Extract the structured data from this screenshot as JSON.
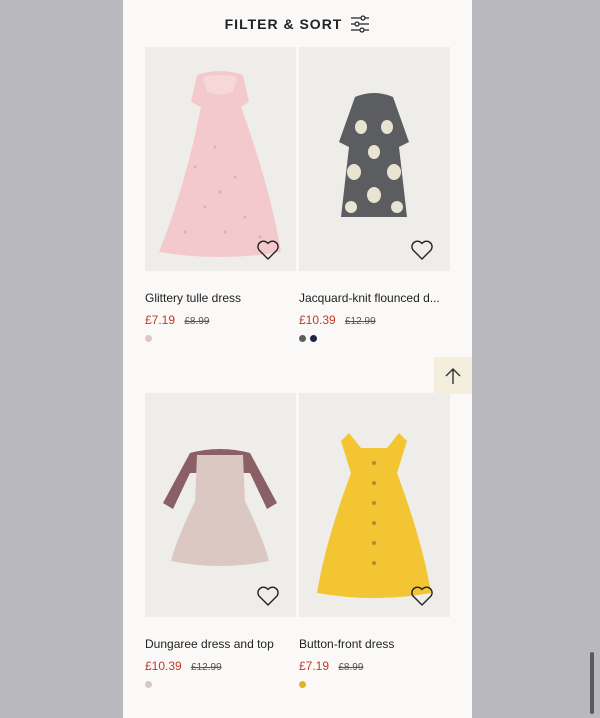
{
  "filter": {
    "label": "FILTER & SORT",
    "icon": "sliders-icon"
  },
  "products": [
    {
      "title": "Glittery tulle dress",
      "price": "£7.19",
      "old_price": "£8.99",
      "swatches": [
        "#e0c5c5"
      ]
    },
    {
      "title": "Jacquard-knit flounced d...",
      "price": "£10.39",
      "old_price": "£12.99",
      "swatches": [
        "#5c5f62",
        "#1f2540"
      ]
    },
    {
      "title": "Dungaree dress and top",
      "price": "£10.39",
      "old_price": "£12.99",
      "swatches": [
        "#d8c7c3"
      ]
    },
    {
      "title": "Button-front dress",
      "price": "£7.19",
      "old_price": "£8.99",
      "swatches": [
        "#e0b12f"
      ]
    }
  ],
  "back_to_top": {
    "icon": "arrow-up-icon"
  },
  "colors": {
    "sale_price": "#c0392b",
    "panel_bg": "#faf9f8",
    "page_bg": "#b9b8bf"
  }
}
